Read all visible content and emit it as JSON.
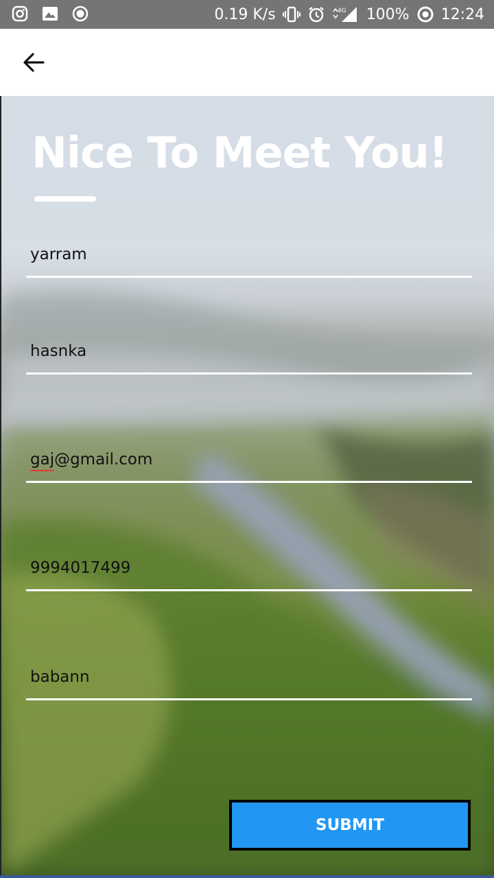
{
  "status_bar": {
    "left_icons": [
      "instagram-icon",
      "image-icon",
      "record-icon"
    ],
    "speed": "0.19 K/s",
    "network": "4G",
    "battery": "100%",
    "time": "12:24"
  },
  "app_bar": {
    "back_icon": "arrow-left-icon"
  },
  "hero": {
    "title": "Nice To Meet You!"
  },
  "form": {
    "fields": [
      {
        "value": "yarram"
      },
      {
        "value": "hasnka"
      },
      {
        "value": "gaj@gmail.com"
      },
      {
        "value": "9994017499"
      },
      {
        "value": "babann"
      }
    ],
    "submit_label": "SUBMIT"
  },
  "colors": {
    "accent": "#2196f3",
    "status_bar": "#757575",
    "spell_error": "#e53935"
  }
}
